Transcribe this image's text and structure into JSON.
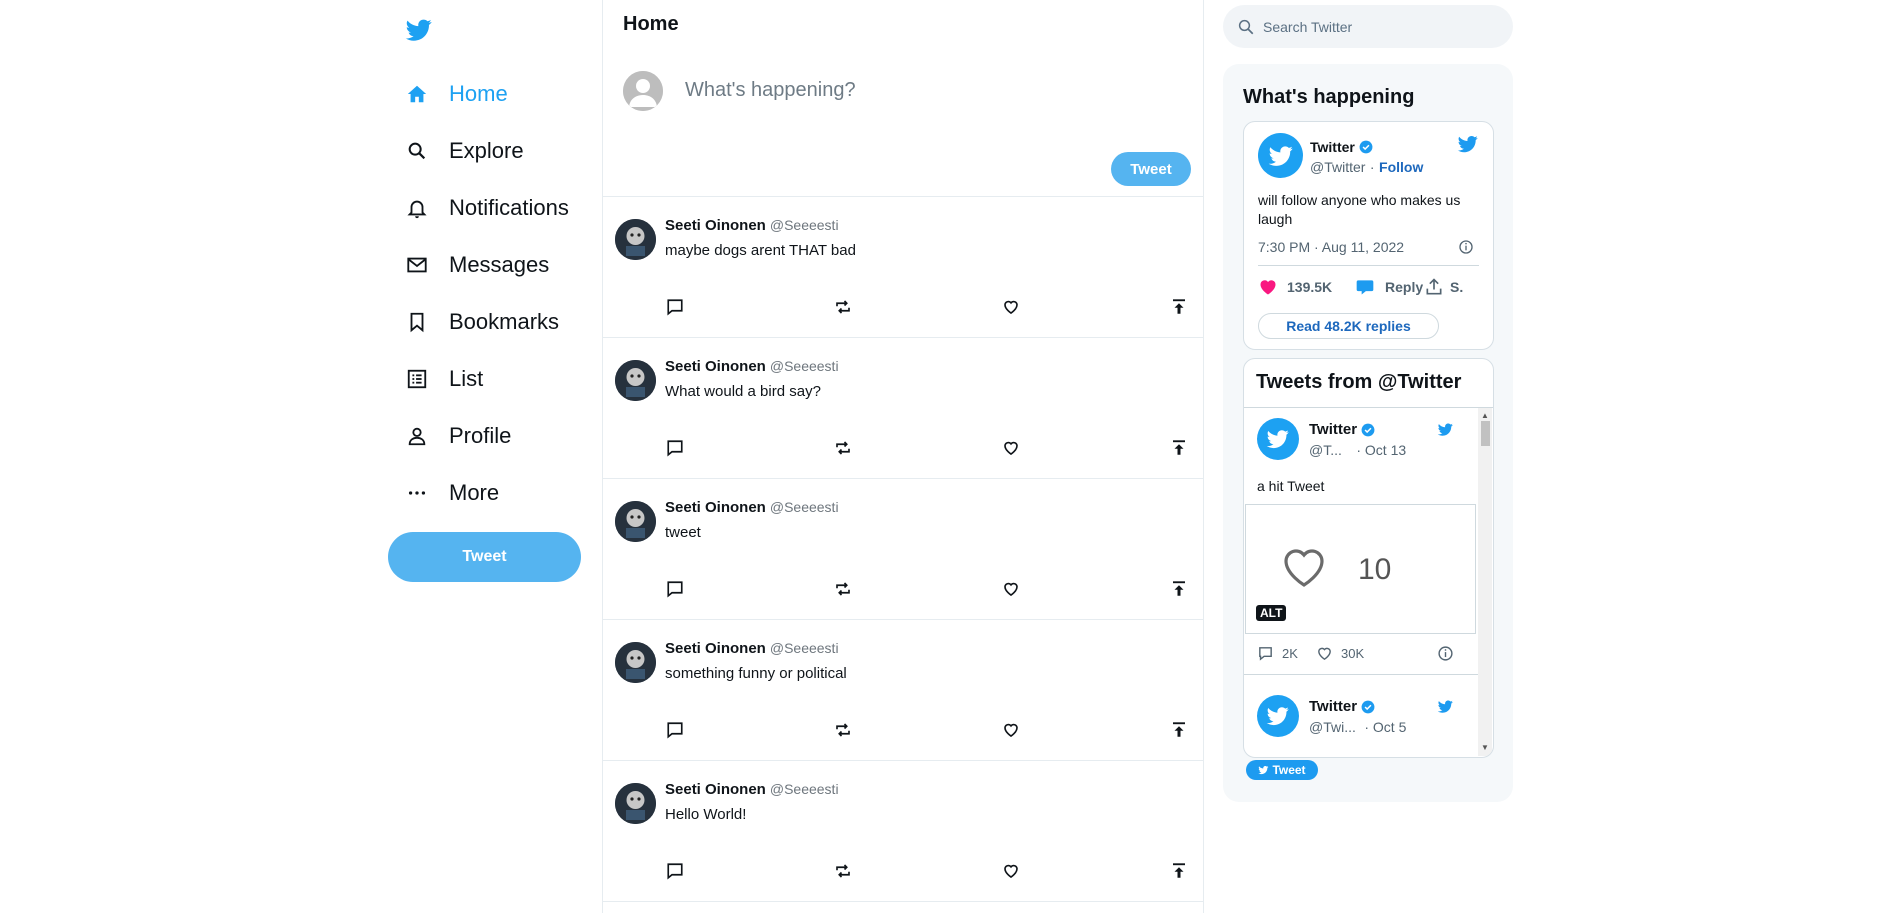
{
  "sidebar": {
    "nav": [
      {
        "label": "Home",
        "icon": "home-icon",
        "active": true
      },
      {
        "label": "Explore",
        "icon": "search-icon"
      },
      {
        "label": "Notifications",
        "icon": "bell-icon"
      },
      {
        "label": "Messages",
        "icon": "mail-icon"
      },
      {
        "label": "Bookmarks",
        "icon": "bookmark-icon"
      },
      {
        "label": "List",
        "icon": "list-icon"
      },
      {
        "label": "Profile",
        "icon": "person-icon"
      },
      {
        "label": "More",
        "icon": "more-icon"
      }
    ],
    "tweet_button": "Tweet"
  },
  "feed": {
    "title": "Home",
    "compose": {
      "placeholder": "What's happening?",
      "button": "Tweet"
    },
    "tweets": [
      {
        "name": "Seeti Oinonen",
        "handle": "@Seeeesti",
        "text": "maybe dogs arent THAT bad"
      },
      {
        "name": "Seeti Oinonen",
        "handle": "@Seeeesti",
        "text": "What would a bird say?"
      },
      {
        "name": "Seeti Oinonen",
        "handle": "@Seeeesti",
        "text": "tweet"
      },
      {
        "name": "Seeti Oinonen",
        "handle": "@Seeeesti",
        "text": "something funny or political"
      },
      {
        "name": "Seeti Oinonen",
        "handle": "@Seeeesti",
        "text": "Hello World!"
      }
    ]
  },
  "right": {
    "search_placeholder": "Search Twitter",
    "trending_title": "What's happening",
    "embed_tweet": {
      "name": "Twitter",
      "handle": "@Twitter",
      "dot": "·",
      "follow": "Follow",
      "text": "will follow anyone who makes us laugh",
      "datetime": "7:30 PM · Aug 11, 2022",
      "likes": "139.5K",
      "reply": "Reply",
      "share": "S.",
      "read_replies": "Read 48.2K replies"
    },
    "timeline": {
      "title": "Tweets from @Twitter",
      "items": [
        {
          "name": "Twitter",
          "handle": "@T...",
          "date": "· Oct 13",
          "text": "a hit Tweet",
          "media_count": "10",
          "alt": "ALT",
          "replies": "2K",
          "likes": "30K"
        },
        {
          "name": "Twitter",
          "handle": "@Twi...",
          "date": "· Oct 5"
        }
      ],
      "tweet_button": "Tweet"
    }
  },
  "colors": {
    "accent": "#1da1f2",
    "button": "#55b4f0",
    "like": "#f91880",
    "link": "#1d68bd"
  }
}
